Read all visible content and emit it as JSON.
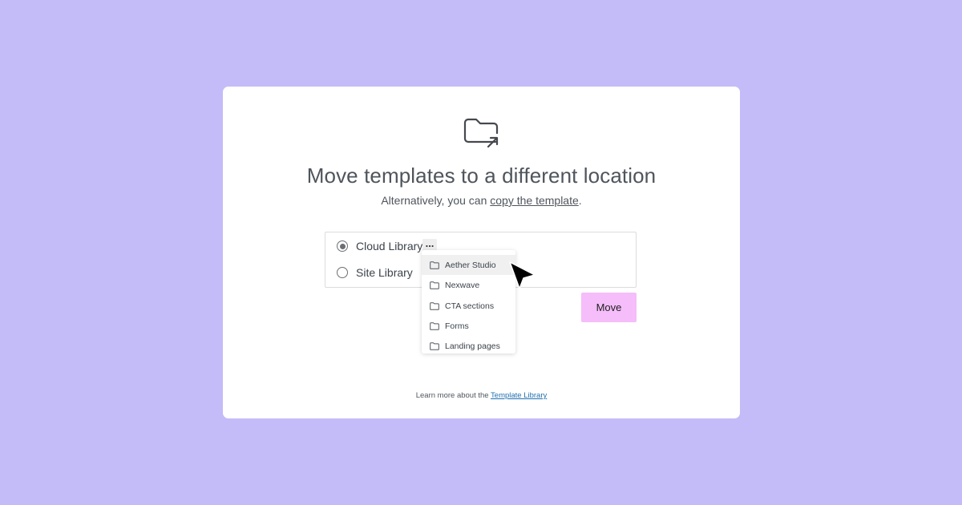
{
  "dialog": {
    "title": "Move templates to a different location",
    "subtitle_prefix": "Alternatively, you can ",
    "subtitle_link": "copy the template",
    "subtitle_suffix": ".",
    "folder_icon": "folder-move-icon"
  },
  "locations": {
    "options": [
      {
        "label": "Cloud Library",
        "checked": true
      },
      {
        "label": "Site Library",
        "checked": false
      }
    ],
    "more_label": "..."
  },
  "dropdown": {
    "items": [
      {
        "label": "Aether Studio",
        "icon": "folder-icon",
        "highlighted": true
      },
      {
        "label": "Nexwave",
        "icon": "folder-icon"
      },
      {
        "label": "CTA sections",
        "icon": "folder-icon"
      },
      {
        "label": "Forms",
        "icon": "folder-icon"
      },
      {
        "label": "Landing pages",
        "icon": "folder-icon"
      }
    ]
  },
  "actions": {
    "move_label": "Move"
  },
  "footer": {
    "prefix": "Learn more about the ",
    "link": "Template Library"
  },
  "colors": {
    "page_background": "#c4bcf8",
    "card_background": "#ffffff",
    "move_button": "#f5bdfa",
    "footer_link": "#2271b1",
    "cursor": "#000000"
  }
}
